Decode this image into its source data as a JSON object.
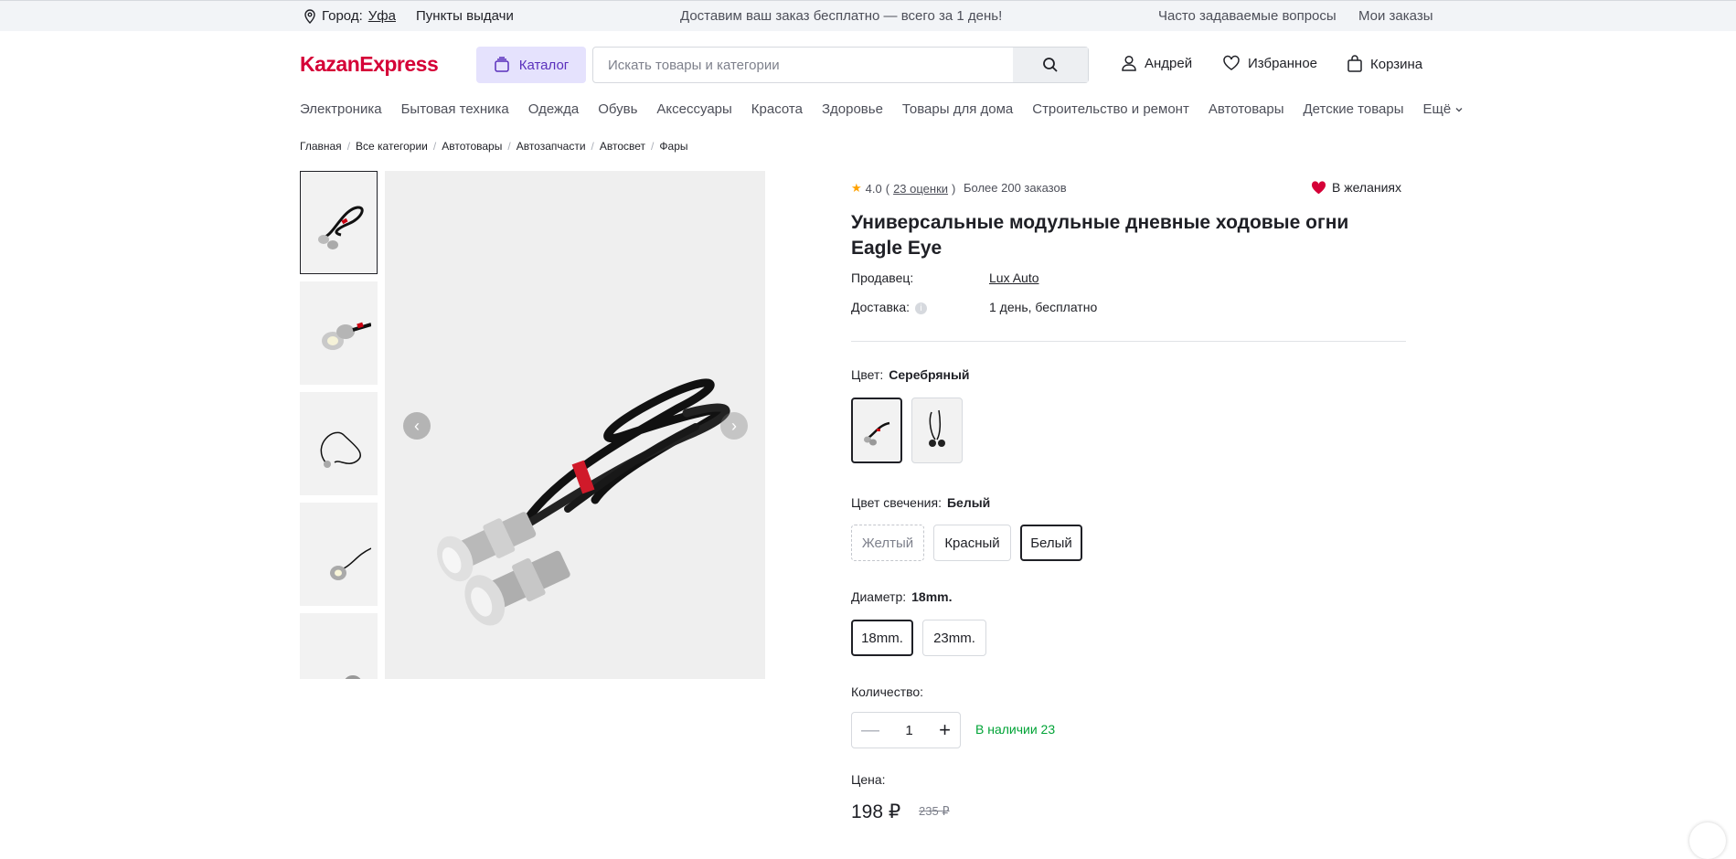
{
  "topbar": {
    "city_label": "Город:",
    "city_value": "Уфа",
    "pickup": "Пункты выдачи",
    "promo": "Доставим ваш заказ бесплатно — всего за 1 день!",
    "faq": "Часто задаваемые вопросы",
    "orders": "Мои заказы"
  },
  "header": {
    "logo": "KazanExpress",
    "catalog_label": "Каталог",
    "search_placeholder": "Искать товары и категории",
    "user": "Андрей",
    "favorites": "Избранное",
    "cart": "Корзина"
  },
  "nav": {
    "items": [
      "Электроника",
      "Бытовая техника",
      "Одежда",
      "Обувь",
      "Аксессуары",
      "Красота",
      "Здоровье",
      "Товары для дома",
      "Строительство и ремонт",
      "Автотовары",
      "Детские товары"
    ],
    "more": "Ещё"
  },
  "breadcrumb": [
    "Главная",
    "Все категории",
    "Автотовары",
    "Автозапчасти",
    "Автосвет",
    "Фары"
  ],
  "product": {
    "rating": "4.0",
    "reviews": "23 оценки",
    "orders": "Более 200 заказов",
    "wishlist": "В желаниях",
    "title": "Универсальные модульные дневные ходовые огни Eagle Eye",
    "seller_label": "Продавец:",
    "seller_value": "Lux Auto",
    "delivery_label": "Доставка:",
    "delivery_value": "1 день, бесплатно",
    "color_label": "Цвет:",
    "color_value": "Серебряный",
    "glow_label": "Цвет свечения:",
    "glow_value": "Белый",
    "glow_options": [
      "Желтый",
      "Красный",
      "Белый"
    ],
    "diameter_label": "Диаметр:",
    "diameter_value": "18mm.",
    "diameter_options": [
      "18mm.",
      "23mm."
    ],
    "qty_label": "Количество:",
    "qty_value": "1",
    "stock": "В наличии 23",
    "price_label": "Цена:",
    "price": "198 ₽",
    "old_price": "235 ₽"
  },
  "colors": {
    "brand": "#d50037",
    "accent": "#5a30bc",
    "in_stock": "#00a336"
  }
}
